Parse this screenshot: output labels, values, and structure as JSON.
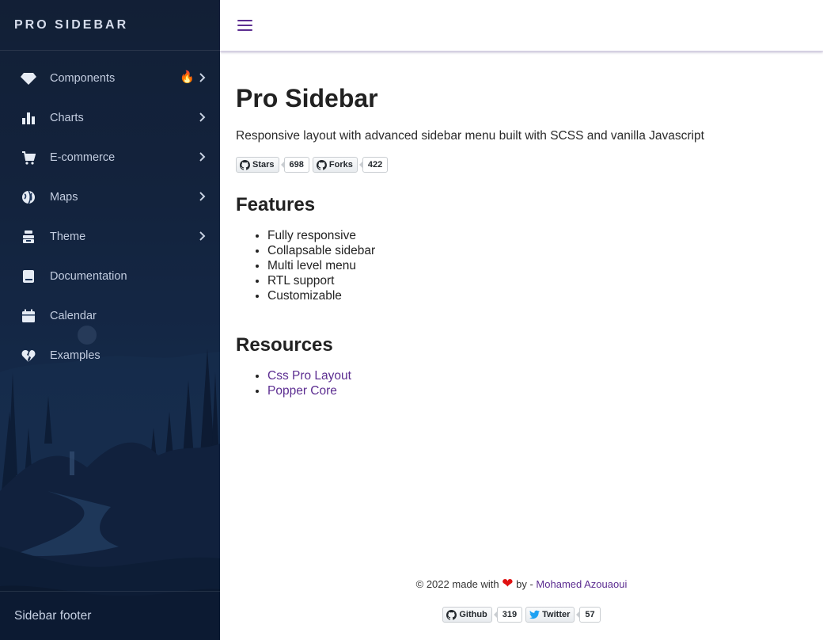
{
  "sidebar": {
    "brand": "PRO SIDEBAR",
    "items": [
      {
        "label": "Components",
        "icon": "diamond-icon",
        "badge": "🔥",
        "has_submenu": true
      },
      {
        "label": "Charts",
        "icon": "bar-chart-icon",
        "has_submenu": true
      },
      {
        "label": "E-commerce",
        "icon": "shopping-cart-icon",
        "has_submenu": true
      },
      {
        "label": "Maps",
        "icon": "globe-icon",
        "has_submenu": true
      },
      {
        "label": "Theme",
        "icon": "paint-roller-icon",
        "has_submenu": true
      },
      {
        "label": "Documentation",
        "icon": "book-icon",
        "has_submenu": false
      },
      {
        "label": "Calendar",
        "icon": "calendar-icon",
        "has_submenu": false
      },
      {
        "label": "Examples",
        "icon": "heart-broken-icon",
        "has_submenu": false
      }
    ],
    "footer": "Sidebar footer"
  },
  "topbar": {
    "menu_icon": "hamburger-icon"
  },
  "main": {
    "title": "Pro Sidebar",
    "intro": "Responsive layout with advanced sidebar menu built with SCSS and vanilla Javascript",
    "badges": [
      {
        "label": "Stars",
        "count": "698",
        "icon": "github-icon"
      },
      {
        "label": "Forks",
        "count": "422",
        "icon": "github-icon"
      }
    ],
    "features_title": "Features",
    "features": [
      "Fully responsive",
      "Collapsable sidebar",
      "Multi level menu",
      "RTL support",
      "Customizable"
    ],
    "resources_title": "Resources",
    "resources": [
      "Css Pro Layout",
      "Popper Core"
    ]
  },
  "footer": {
    "prefix": "© 2022 made with",
    "heart": "❤",
    "by": "by -",
    "author": "Mohamed Azouaoui",
    "badges": [
      {
        "label": "Github",
        "count": "319",
        "icon": "github-icon"
      },
      {
        "label": "Twitter",
        "count": "57",
        "icon": "twitter-icon"
      }
    ]
  },
  "colors": {
    "accent": "#5c2d91",
    "sidebar_bg": "#172b4a",
    "heart": "#e01010"
  }
}
